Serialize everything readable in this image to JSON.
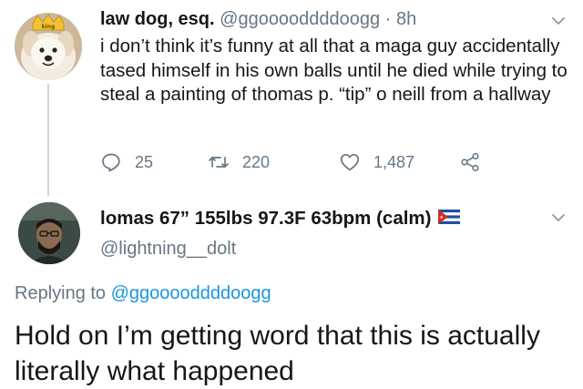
{
  "tweet": {
    "author_name": "law dog, esq.",
    "author_handle": "@ggooooddddoogg",
    "separator": "·",
    "time": "8h",
    "avatar_badge": "king",
    "text": "i don’t think it’s funny at all that a maga guy accidentally tased himself in his own balls until he died while trying to steal a painting of thomas p. “tip” o neill from a hallway",
    "actions": {
      "replies": "25",
      "retweets": "220",
      "likes": "1,487"
    }
  },
  "reply": {
    "author_name": "lomas 67” 155lbs 97.3F 63bpm (calm)",
    "author_handle": "@lightning__dolt",
    "replying_prefix": "Replying to",
    "replying_to": "@ggooooddddoogg",
    "text": "Hold on I’m getting word that this is actually literally what happened"
  },
  "icons": {
    "reply": "reply-icon",
    "retweet": "retweet-icon",
    "like": "heart-icon",
    "share": "share-icon",
    "more": "chevron-down-icon",
    "flag": "cuba-flag-icon"
  },
  "colors": {
    "text": "#14171a",
    "muted": "#657786",
    "link": "#1b95e0",
    "divider": "#ccd6dd"
  }
}
